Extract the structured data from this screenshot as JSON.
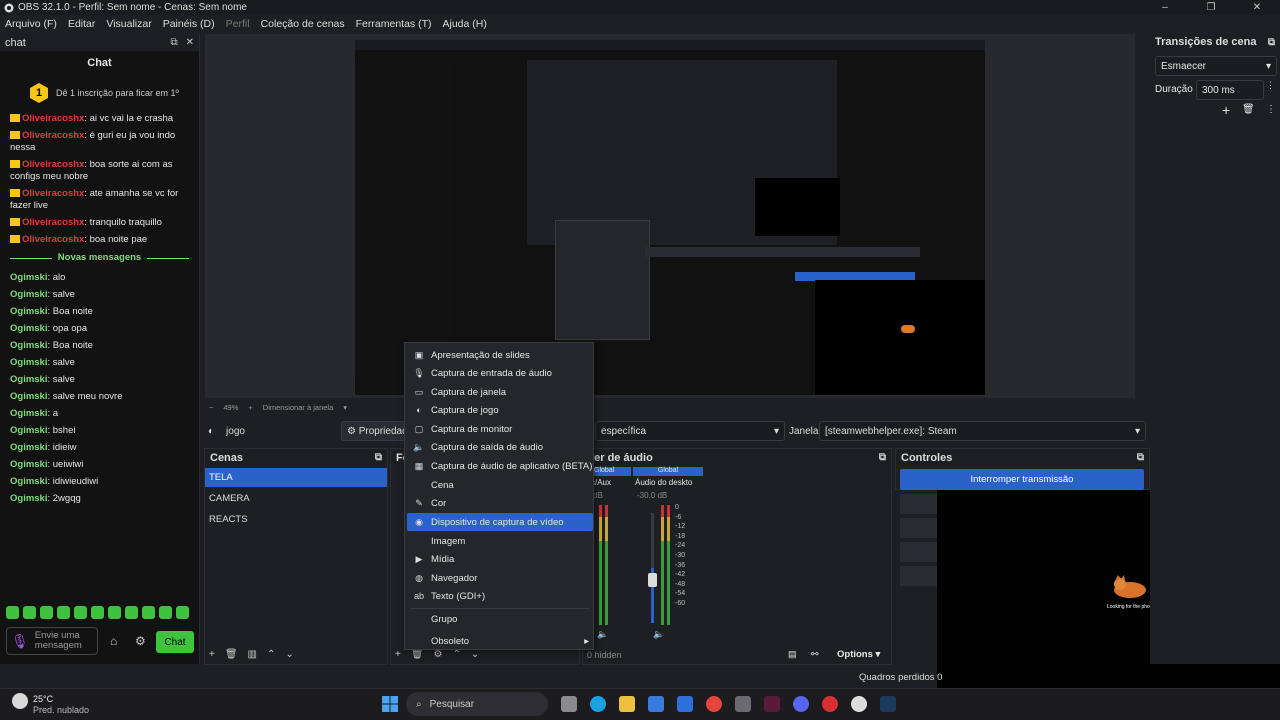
{
  "window": {
    "title": "OBS 32.1.0 - Perfil: Sem nome - Cenas: Sem nome",
    "controls": [
      "–",
      "❐",
      "✕"
    ]
  },
  "menu": [
    "Arquivo (F)",
    "Editar",
    "Visualizar",
    "Painéis (D)",
    "Perfil",
    "Coleção de cenas",
    "Ferramentas (T)",
    "Ajuda (H)"
  ],
  "chat": {
    "dock_title": "chat",
    "title": "Chat",
    "pin_number": "1",
    "pin_text": "Dê 1 inscrição para ficar em 1º",
    "messages_top": [
      {
        "user": "Oliveiracoshx",
        "text": ": ai vc vai la e crasha"
      },
      {
        "user": "Oliveiracoshx",
        "text": ": é guri eu ja vou indo nessa"
      },
      {
        "user": "Oliveiracoshx",
        "text": ": boa sorte ai com as configs meu nobre"
      },
      {
        "user": "Oliveiracoshx",
        "text": ": ate amanha se vc for fazer live"
      },
      {
        "user": "Oliveiracoshx",
        "text": ": tranquilo traquillo"
      },
      {
        "user": "Oliveiracoshx",
        "text": ": boa noite pae"
      }
    ],
    "new_messages_label": "Novas mensagens",
    "messages_new": [
      {
        "user": "Ogimski",
        "text": ": alo"
      },
      {
        "user": "Ogimski",
        "text": ": salve"
      },
      {
        "user": "Ogimski",
        "text": ": Boa noite"
      },
      {
        "user": "Ogimski",
        "text": ": opa opa"
      },
      {
        "user": "Ogimski",
        "text": ": Boa noite"
      },
      {
        "user": "Ogimski",
        "text": ": salve"
      },
      {
        "user": "Ogimski",
        "text": ": salve"
      },
      {
        "user": "Ogimski",
        "text": ": salve meu novre"
      },
      {
        "user": "Ogimski",
        "text": ": a"
      },
      {
        "user": "Ogimski",
        "text": ": bshei"
      },
      {
        "user": "Ogimski",
        "text": ": idieiw"
      },
      {
        "user": "Ogimski",
        "text": ": ueiwiwi"
      },
      {
        "user": "Ogimski",
        "text": ": idiwieudiwi"
      },
      {
        "user": "Ogimski",
        "text": ": 2wgqg"
      }
    ],
    "input_placeholder": "Envie uma mensagem",
    "send_label": "Chat"
  },
  "preview": {
    "zoom": "49%",
    "resize_label": "Dimensionar à janela"
  },
  "context_bar": {
    "source_name": "jogo",
    "properties_label": "Propriedades",
    "mode_value": "específica",
    "window_label": "Janela",
    "window_value": "[steamwebhelper.exe]: Steam"
  },
  "scenes": {
    "title": "Cenas",
    "items": [
      "TELA",
      "CAMERA",
      "REACTS"
    ],
    "selected": 0
  },
  "sources": {
    "title": "Fo"
  },
  "mixer": {
    "title": "xer de áudio",
    "channels": [
      {
        "scope": "Global",
        "name": "c/Aux",
        "level": "dB"
      },
      {
        "scope": "Global",
        "name": "Áudio do deskto",
        "level": "-30.0 dB"
      }
    ],
    "ticks": [
      "0",
      "-6",
      "-12",
      "-18",
      "-24",
      "-30",
      "-36",
      "-42",
      "-48",
      "-54",
      "-60"
    ],
    "hidden_count": "0 hidden",
    "options_label": "Options"
  },
  "controls": {
    "title": "Controles",
    "stream_button": "Interromper transmissão"
  },
  "transitions": {
    "title": "Transições de cena",
    "type_value": "Esmaecer",
    "duration_label": "Duração",
    "duration_value": "300 ms"
  },
  "context_menu": {
    "items": [
      {
        "label": "Apresentação de slides",
        "icon": "slideshow-icon"
      },
      {
        "label": "Captura de entrada de áudio",
        "icon": "microphone-icon"
      },
      {
        "label": "Captura de janela",
        "icon": "window-icon"
      },
      {
        "label": "Captura de jogo",
        "icon": "gamepad-icon"
      },
      {
        "label": "Captura de monitor",
        "icon": "monitor-icon"
      },
      {
        "label": "Captura de saída de áudio",
        "icon": "speaker-icon"
      },
      {
        "label": "Captura de áudio de aplicativo (BETA)",
        "icon": "app-audio-icon"
      },
      {
        "label": "Cena",
        "icon": "scene-icon"
      },
      {
        "label": "Cor",
        "icon": "brush-icon"
      },
      {
        "label": "Dispositivo de captura de vídeo",
        "icon": "camera-icon"
      },
      {
        "label": "Imagem",
        "icon": "image-icon"
      },
      {
        "label": "Mídia",
        "icon": "play-icon"
      },
      {
        "label": "Navegador",
        "icon": "globe-icon"
      },
      {
        "label": "Texto (GDI+)",
        "icon": "text-icon"
      },
      {
        "label": "Grupo",
        "icon": "group-icon"
      },
      {
        "label": "Obsoleto",
        "icon": "submenu-arrow-icon"
      }
    ],
    "selected_index": 9
  },
  "status": {
    "dropped_frames": "Quadros perdidos 0"
  },
  "overlay": {
    "caption": "Looking for the phone"
  },
  "taskbar": {
    "weather_temp": "25°C",
    "weather_desc": "Pred. nublado",
    "search_placeholder": "Pesquisar"
  }
}
